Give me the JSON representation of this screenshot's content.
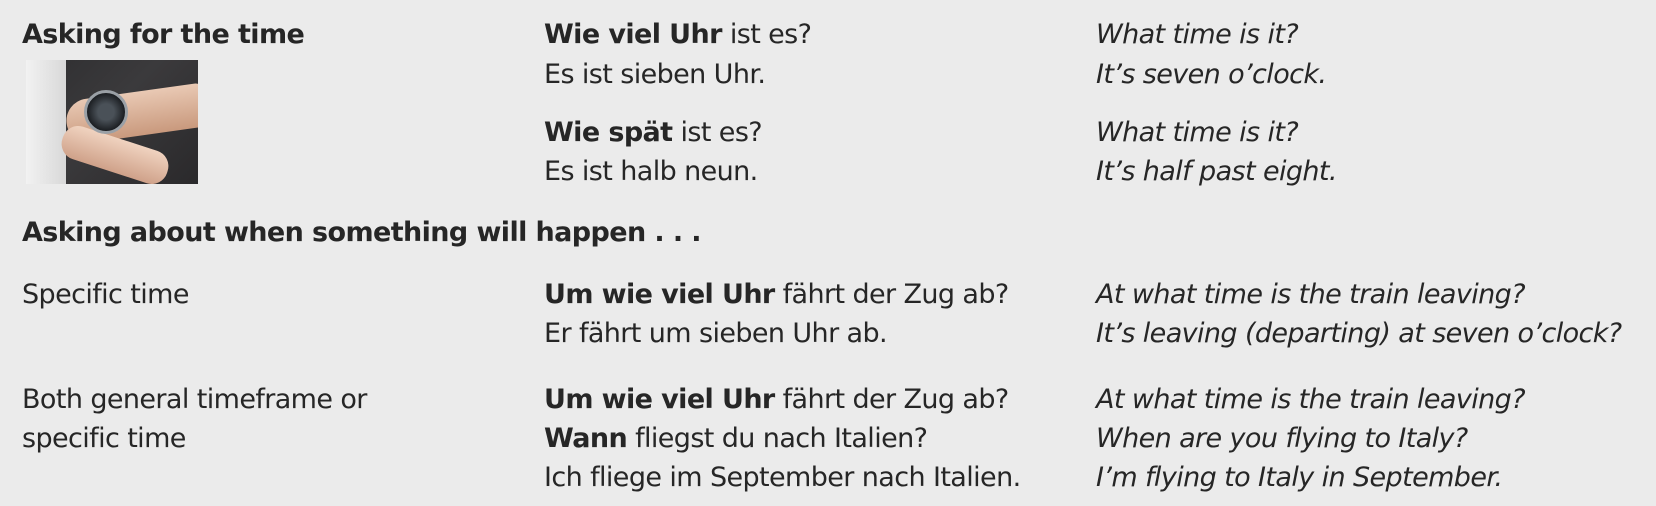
{
  "section1": {
    "heading": "Asking for the time",
    "photo_alt": "watch-on-wrist",
    "rows": [
      {
        "german_bold": "Wie viel Uhr",
        "german_rest": " ist es?",
        "german_line2": "Es ist sieben Uhr.",
        "english_line1": "What time is it?",
        "english_line2": "It’s seven o’clock."
      },
      {
        "german_bold": "Wie spät",
        "german_rest": " ist es?",
        "german_line2": "Es ist halb neun.",
        "english_line1": "What time is it?",
        "english_line2": "It’s half past eight."
      }
    ]
  },
  "section2": {
    "heading": "Asking about when something will happen . . .",
    "specific": {
      "label": "Specific time",
      "german_bold": "Um wie viel Uhr",
      "german_rest": " fährt der Zug ab?",
      "german_line2": "Er fährt um sieben Uhr ab.",
      "english_line1": "At what time is the train leaving?",
      "english_line2": "It’s leaving (departing) at seven o’clock?"
    },
    "both": {
      "label_line1": "Both general timeframe or",
      "label_line2": "specific time",
      "line1_bold": "Um wie viel Uhr",
      "line1_rest": " fährt der Zug ab?",
      "line2_bold": "Wann",
      "line2_rest": " fliegst du nach Italien?",
      "line3": "Ich fliege im September nach Italien.",
      "english_line1": "At what time is the train leaving?",
      "english_line2": "When are you flying to Italy?",
      "english_line3": "I’m flying to Italy in September."
    }
  }
}
